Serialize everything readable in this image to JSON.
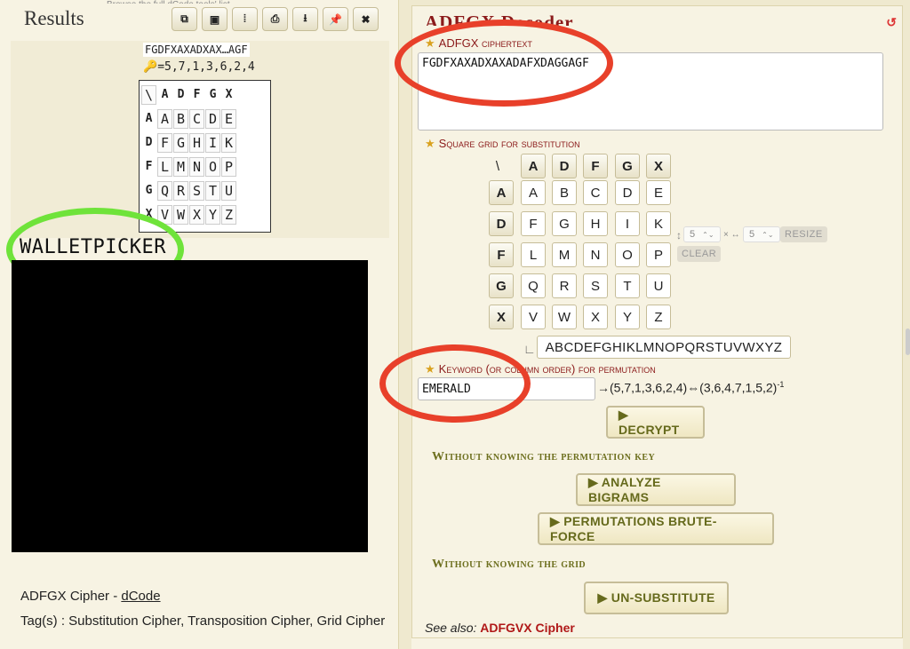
{
  "results": {
    "title": "Results",
    "top_partial_text": "Browse the full dCode tools' list",
    "toolbar": [
      {
        "name": "copy-icon",
        "glyph": "⧉"
      },
      {
        "name": "screenshot-icon",
        "glyph": "▣"
      },
      {
        "name": "columns-icon",
        "glyph": "⦙"
      },
      {
        "name": "print-icon",
        "glyph": "⎙"
      },
      {
        "name": "download-icon",
        "glyph": "⭳"
      },
      {
        "name": "pin-icon",
        "glyph": "📌"
      },
      {
        "name": "close-icon",
        "glyph": "✖"
      }
    ],
    "cipher_short": "FGDFXAXADXAX…AGF",
    "key_line": "=5,7,1,3,6,2,4",
    "grid": [
      [
        "\\",
        "A",
        "D",
        "F",
        "G",
        "X"
      ],
      [
        "A",
        "A",
        "B",
        "C",
        "D",
        "E"
      ],
      [
        "D",
        "F",
        "G",
        "H",
        "I",
        "K"
      ],
      [
        "F",
        "L",
        "M",
        "N",
        "O",
        "P"
      ],
      [
        "G",
        "Q",
        "R",
        "S",
        "T",
        "U"
      ],
      [
        "X",
        "V",
        "W",
        "X",
        "Y",
        "Z"
      ]
    ],
    "overlay_text": "WALLETPICKER",
    "credit_text": "ADFGX Cipher - ",
    "credit_link": "dCode",
    "tags": "Tag(s) : Substitution Cipher, Transposition Cipher, Grid Cipher"
  },
  "decoder": {
    "title": "ADFGX Decoder",
    "ciphertext_label": "ADFGX ciphertext",
    "ciphertext_value": "FGDFXAXADXAXADAFXDAGGAGF",
    "grid_label": "Square grid for substitution",
    "grid_headers": [
      "A",
      "D",
      "F",
      "G",
      "X"
    ],
    "grid_rows": [
      [
        "A",
        "B",
        "C",
        "D",
        "E"
      ],
      [
        "F",
        "G",
        "H",
        "I",
        "K"
      ],
      [
        "L",
        "M",
        "N",
        "O",
        "P"
      ],
      [
        "Q",
        "R",
        "S",
        "T",
        "U"
      ],
      [
        "V",
        "W",
        "X",
        "Y",
        "Z"
      ]
    ],
    "rows_value": "5",
    "cols_value": "5",
    "resize_label": "RESIZE",
    "clear_label": "CLEAR",
    "alphabet_value": "ABCDEFGHIKLMNOPQRSTUVWXYZ",
    "keyword_label": "Keyword (or column order) for permutation",
    "keyword_value": "EMERALD",
    "permutation_text": "→(5,7,1,3,6,2,4)⇔(3,6,4,7,1,5,2)",
    "permutation_sup": "-1",
    "decrypt_label": "▶ DECRYPT",
    "section_no_key": "Without knowing the permutation key",
    "analyze_label": "▶ ANALYZE BIGRAMS",
    "brute_label": "▶ PERMUTATIONS BRUTE-FORCE",
    "section_no_grid": "Without knowing the grid",
    "unsub_label": "▶ UN-SUBSTITUTE",
    "see_also_prefix": "See also: ",
    "see_also_link": "ADFGVX Cipher"
  }
}
